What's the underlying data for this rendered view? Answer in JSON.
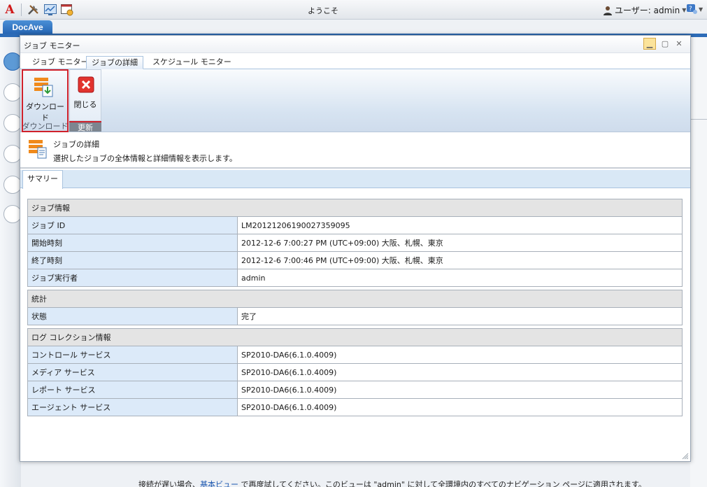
{
  "topbar": {
    "logo_letter": "A",
    "icons": [
      "tools-icon",
      "monitor-chart-icon",
      "calendar-window-icon"
    ],
    "welcome": "ようこそ",
    "user_label": "ユーザー: admin",
    "help_icon": "help-icon"
  },
  "app_tab": "DocAve",
  "dialog": {
    "title": "ジョブ モニター",
    "tabs": [
      {
        "label": "ジョブ モニター"
      },
      {
        "label": "ジョブの詳細",
        "active": true
      },
      {
        "label": "スケジュール モニター"
      }
    ],
    "ribbon": {
      "download_label": "ダウンロード",
      "close_label": "閉じる",
      "group_download": "ダウンロード",
      "group_update": "更新"
    },
    "info": {
      "title": "ジョブの詳細",
      "description": "選択したジョブの全体情報と詳細情報を表示します。"
    },
    "summary_tab": "サマリー",
    "sections": [
      {
        "header": "ジョブ情報",
        "rows": [
          {
            "key": "ジョブ ID",
            "value": "LM20121206190027359095"
          },
          {
            "key": "開始時刻",
            "value": "2012-12-6 7:00:27 PM (UTC+09:00) 大阪、札幌、東京"
          },
          {
            "key": "終了時刻",
            "value": "2012-12-6 7:00:46 PM (UTC+09:00) 大阪、札幌、東京"
          },
          {
            "key": "ジョブ実行者",
            "value": "admin"
          }
        ]
      },
      {
        "header": "統計",
        "rows": [
          {
            "key": "状態",
            "value": "完了"
          }
        ]
      },
      {
        "header": "ログ コレクション情報",
        "rows": [
          {
            "key": "コントロール サービス",
            "value": "SP2010-DA6(6.1.0.4009)"
          },
          {
            "key": "メディア サービス",
            "value": "SP2010-DA6(6.1.0.4009)"
          },
          {
            "key": "レポート サービス",
            "value": "SP2010-DA6(6.1.0.4009)"
          },
          {
            "key": "エージェント サービス",
            "value": "SP2010-DA6(6.1.0.4009)"
          }
        ]
      }
    ]
  },
  "bottom_message": {
    "before": "接続が遅い場合、",
    "link": "基本ビュー",
    "after": " で再度試してください。このビューは \"admin\" に対して全環境内のすべてのナビゲーション ページに適用されます。"
  },
  "colors": {
    "accent_blue": "#2c6bb7",
    "highlight_red": "#d0212b",
    "key_cell_bg": "#dceaf9",
    "section_bg": "#e4e4e4"
  }
}
